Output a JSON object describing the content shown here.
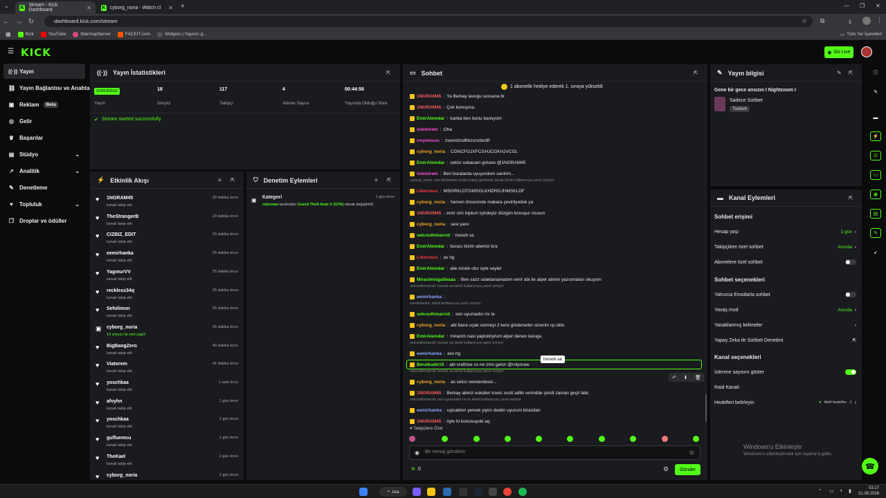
{
  "browser": {
    "tabs": [
      {
        "label": "Stream - Kick Dashboard"
      },
      {
        "label": "cyborg_noria - Watch clips on K"
      }
    ],
    "url": "dashboard.kick.com/stream",
    "bookmarks": [
      "Kick",
      "YouTube",
      "WarmupServer",
      "FACEIT.com",
      "Widgets | Yayıncı g..."
    ],
    "all_bookmarks": "Tüm Yer İşaretleri"
  },
  "header": {
    "logo": "KICK",
    "go_live": "Go Live"
  },
  "sidebar": {
    "items": [
      {
        "label": "Yayın",
        "icon": "broadcast-icon"
      },
      {
        "label": "Yayın Bağlantısı ve Anahtar",
        "icon": "link-icon"
      },
      {
        "label": "Reklam",
        "icon": "ad-icon",
        "badge": "Beta"
      },
      {
        "label": "Gelir",
        "icon": "money-icon"
      },
      {
        "label": "Başarılar",
        "icon": "trophy-icon"
      },
      {
        "label": "Stüdyo",
        "icon": "studio-icon"
      },
      {
        "label": "Analitik",
        "icon": "chart-icon"
      },
      {
        "label": "Denetleme",
        "icon": "wrench-icon"
      },
      {
        "label": "Topluluk",
        "icon": "heart-icon"
      },
      {
        "label": "Droplar ve ödüller",
        "icon": "gift-icon"
      }
    ]
  },
  "stats": {
    "title": "Yayın İstatistikleri",
    "status_badge": "SORUNSUZ",
    "items": [
      {
        "value": "",
        "label": "Yayın"
      },
      {
        "value": "18",
        "label": "İzleyici"
      },
      {
        "value": "117",
        "label": "Takipçi"
      },
      {
        "value": "4",
        "label": "Abone Sayısı"
      },
      {
        "value": "00:44:56",
        "label": "Yayında Olduğu Süre"
      }
    ],
    "notice": "Stream started successfully."
  },
  "activity": {
    "title": "Etkinlik Akışı",
    "items": [
      {
        "name": "1NGRAM45",
        "sub": "kanalı takip etti",
        "time": "20 dakika önce"
      },
      {
        "name": "TheStrangerB",
        "sub": "kanalı takip etti",
        "time": "23 dakika önce"
      },
      {
        "name": "CIZBIZ_EDIT",
        "sub": "kanalı takip etti",
        "time": "23 dakika önce"
      },
      {
        "name": "eemirhanka",
        "sub": "kanalı takip etti",
        "time": "25 dakika önce"
      },
      {
        "name": "YagmurVV",
        "sub": "kanalı takip etti",
        "time": "25 dakika önce"
      },
      {
        "name": "reckless34q",
        "sub": "kanalı takip etti",
        "time": "25 dakika önce"
      },
      {
        "name": "Sefolimon",
        "sub": "kanalı takip etti",
        "time": "25 dakika önce"
      },
      {
        "name": "cyborg_noria",
        "sub": "14 izleyici ile raid yaptı!",
        "time": "26 dakika önce",
        "raid": true
      },
      {
        "name": "BigBangZero",
        "sub": "kanalı takip etti",
        "time": "40 dakika önce"
      },
      {
        "name": "Viatorem",
        "sub": "kanalı takip etti",
        "time": "41 dakika önce"
      },
      {
        "name": "yoschkaa",
        "sub": "kanalı takip etti",
        "time": "1 saat önce"
      },
      {
        "name": "afvyhn",
        "sub": "kanalı takip etti",
        "time": "1 gün önce"
      },
      {
        "name": "yoschkaa",
        "sub": "kanalı takip etti",
        "time": "1 gün önce"
      },
      {
        "name": "gulfuemcu",
        "sub": "kanalı takip etti",
        "time": "1 gün önce"
      },
      {
        "name": "TheKael",
        "sub": "kanalı takip etti",
        "time": "1 gün önce"
      },
      {
        "name": "cyborg_noria",
        "sub": "",
        "time": "1 gün önce"
      }
    ]
  },
  "moderation": {
    "title": "Denetim Eylemleri",
    "item": {
      "heading": "Kategori",
      "user": "rolynraw",
      "mid": " tarafından ",
      "game": "Grand Theft Auto V (GTA)",
      "tail": " olarak değiştirildi",
      "time": "1 gün önce"
    }
  },
  "chat": {
    "title": "Sohbet",
    "pinned": "1 abonelik hediye ederek 1. sıraya yükseldi",
    "messages": [
      {
        "user": "1NGRAM45",
        "color": "#ff5c5c",
        "text": "Ya Berkay lavugu sussana bi"
      },
      {
        "user": "1NGRAM45",
        "color": "#ff5c5c",
        "text": "Çok konuşma."
      },
      {
        "user": "EmirAlemdar",
        "color": "#53fc18",
        "text": "kanka ben bunu banlıyom"
      },
      {
        "user": "istemirem",
        "color": "#ff4fd8",
        "text": "Oha"
      },
      {
        "user": "rreyemuss",
        "color": "#ff4fd8",
        "text": "zsexrdzsdtfezsrxdsrdtf"
      },
      {
        "user": "cyborg_noria",
        "color": "#f5a623",
        "text": "CGNCFGJXFCGHJCGKHJVCGL"
      },
      {
        "user": "EmirAlemdar",
        "color": "#53fc18",
        "text": "cekici sokacam gotune @1NGRAM45"
      },
      {
        "user": "istemirem",
        "color": "#ff4fd8",
        "text": "Ben buralarda uyuyordum sanirim..."
      },
      {
        "user": "Liberosss",
        "color": "#ff3b3b",
        "text": "MSGRKLDTGMSGLKHDRGJHMSKLDF",
        "reply": "cyborg_noria: yav böylerken chate bakıp gülmese lanuk isimli kullanıcıya yanıt veriyor"
      },
      {
        "user": "cyborg_noria",
        "color": "#f5a623",
        "text": "hemen öncesinde makara çevirilyoduk ya"
      },
      {
        "user": "1NGRAM45",
        "color": "#ff5c5c",
        "text": "emir cim toplum içindeyiz düzgün konuşur musun"
      },
      {
        "user": "cyborg_noria",
        "color": "#f5a623",
        "text": "sesi yavv"
      },
      {
        "user": "selcouthmarcid",
        "color": "#53fc18",
        "text": "hooob sa"
      },
      {
        "user": "EmirAlemdar",
        "color": "#53fc18",
        "text": "burası bizim ailemiz bra"
      },
      {
        "user": "Liberosss",
        "color": "#ff3b3b",
        "text": "as hg"
      },
      {
        "user": "EmirAlemdar",
        "color": "#53fc18",
        "text": "aile icinde olur oyle seyler"
      },
      {
        "user": "Miraclmisgalibaaa",
        "color": "#53fc18",
        "text": "Ben sazz odaklanamadım emir abi ile alper abinin yazısmaları okuyom"
      },
      {
        "user": "eemirhanka",
        "color": "#8ea6ff",
        "text": "",
        "reply": "selcouthmarcid: hooob sa isimli kullanıcıya yanıt veriyor"
      },
      {
        "user": "selcouthmarcid",
        "color": "#53fc18",
        "text": "sen uyumadın mı la",
        "reply": "eemirhanka: isimli kullanıcıya yanıt veriyor"
      },
      {
        "user": "cyborg_noria",
        "color": "#f5a623",
        "text": "abi bana uçak sürmeyi 2 kere gösterseler sürerim işi oldu"
      },
      {
        "user": "EmirAlemdar",
        "color": "#53fc18",
        "text": "miracim nasi yapistiriyrum alper denen lavuga"
      },
      {
        "user": "eemirhanka",
        "color": "#8ea6ff",
        "text": "ass hg",
        "reply": "selcouthmarcid: hooob sa isimli kullanıcıya yanıt veriyor"
      },
      {
        "user": "Beratkadir19",
        "color": "#53fc18",
        "text": "abi craftrise vs ne zmn gelcn @rolynraw",
        "highlight": true
      },
      {
        "user": "cyborg_noria",
        "color": "#f5a623",
        "text": "as selco nerelerdesin...",
        "reply": "selcouthmarcid: hooob sa isimli kullanıcıya yanıt veriyor"
      },
      {
        "user": "1NGRAM45",
        "color": "#ff5c5c",
        "text": "Berkay abiniz eskiden travis scott adlib veriridde şimdi zaman geçti tabi."
      },
      {
        "user": "eemirhanka",
        "color": "#8ea6ff",
        "text": "uyicaktım yemek yiyim dedim uyurum birazdan",
        "reply": "selcouthmarcid: sen uyumadın mı la isimli kullanıcıya yanıt veriyor"
      },
      {
        "user": "1NGRAM45",
        "color": "#ff5c5c",
        "text": "öyle bi konusuyoki aq"
      }
    ],
    "tooltip": "hooob sa",
    "followers_only": "Takipçilere Özel",
    "input_placeholder": "Bir mesaj gönderin",
    "count": "0",
    "send_label": "Gönder"
  },
  "stream_info": {
    "title": "Yayın bilgisi",
    "stream_title": "Gene bir gece ansızın I Nightzoom I",
    "category": "Sadece Sohbet",
    "language": "Turkish"
  },
  "channel_actions": {
    "title": "Kanal Eylemleri",
    "chat_access_title": "Sohbet erişimi",
    "access_rows": [
      {
        "label": "Hesap yaşı",
        "value": "1 gün"
      },
      {
        "label": "Takipçilere özel sohbet",
        "value": "Anında"
      },
      {
        "label": "Abonelere özel sohbet",
        "toggle": "off"
      }
    ],
    "chat_options_title": "Sohbet seçenekleri",
    "option_rows": [
      {
        "label": "Yalnızca Emotlarla sohbet",
        "toggle": "off"
      },
      {
        "label": "Yavaş mod",
        "value": "Anında"
      },
      {
        "label": "Yasaklanmış kelimeler",
        "value": ""
      },
      {
        "label": "Yapay Zeka ile Sohbet Denetimi",
        "value": ""
      }
    ],
    "channel_options_title": "Kanal seçenekleri",
    "channel_rows": [
      {
        "label": "İzlenme sayısını göster",
        "toggle": "on"
      },
      {
        "label": "Raid Kanalı",
        "value": ""
      },
      {
        "label": "Hedefleri belirleyin",
        "value": "Aktif hedefler - 1"
      }
    ]
  },
  "watermark": {
    "line1": "Windows'u Etkinleştir",
    "line2": "Windows'u etkinleştirmek için Ayarlar'a gidin."
  },
  "taskbar": {
    "search": "Ara",
    "time": "03:27",
    "date": "21.08.2026"
  },
  "colors": {
    "accent": "#53fc18",
    "panel": "#191b1f",
    "background": "#0b0b0c"
  }
}
